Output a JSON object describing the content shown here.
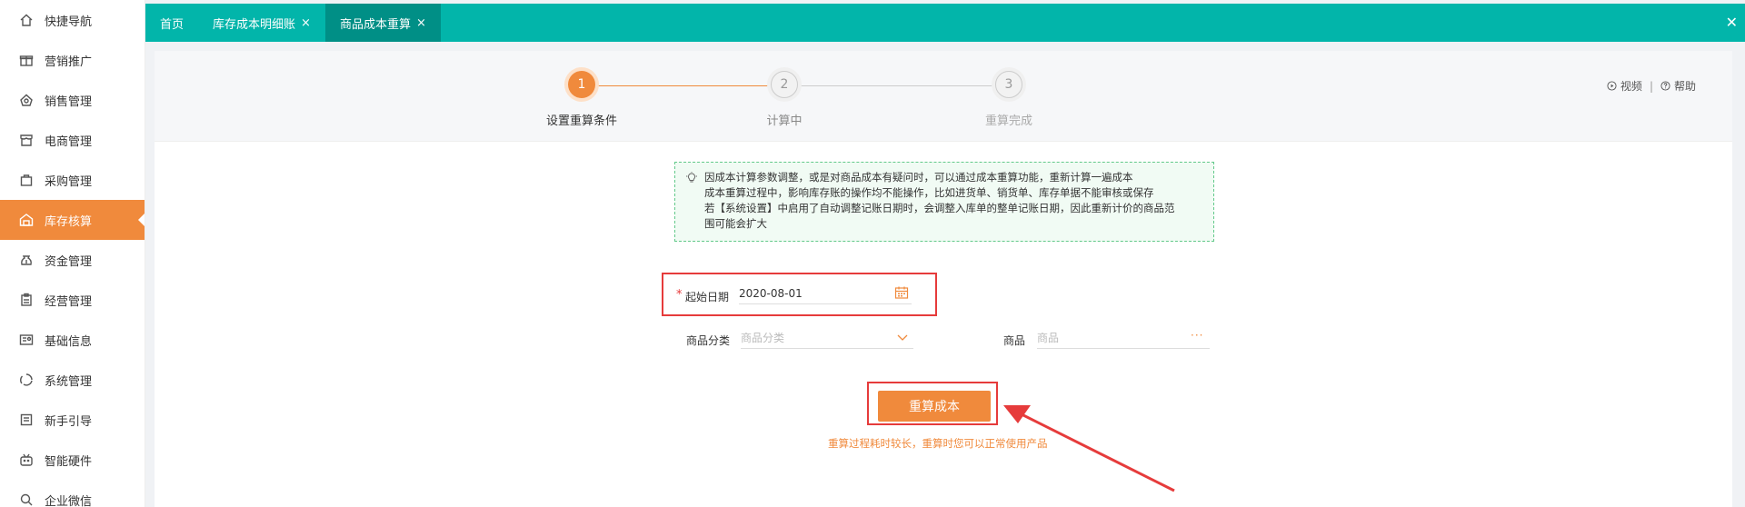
{
  "sidebar": {
    "items": [
      {
        "label": "快捷导航",
        "icon": "home-icon"
      },
      {
        "label": "营销推广",
        "icon": "gift-icon"
      },
      {
        "label": "销售管理",
        "icon": "sales-icon"
      },
      {
        "label": "电商管理",
        "icon": "store-icon"
      },
      {
        "label": "采购管理",
        "icon": "bag-icon"
      },
      {
        "label": "库存核算",
        "icon": "warehouse-icon"
      },
      {
        "label": "资金管理",
        "icon": "money-bag-icon"
      },
      {
        "label": "经营管理",
        "icon": "clipboard-icon"
      },
      {
        "label": "基础信息",
        "icon": "id-card-icon"
      },
      {
        "label": "系统管理",
        "icon": "cycle-icon"
      },
      {
        "label": "新手引导",
        "icon": "guide-icon"
      },
      {
        "label": "智能硬件",
        "icon": "device-icon"
      },
      {
        "label": "企业微信",
        "icon": "search-icon"
      }
    ],
    "active_index": 5
  },
  "tabs": [
    {
      "label": "首页",
      "closable": false
    },
    {
      "label": "库存成本明细账",
      "closable": true
    },
    {
      "label": "商品成本重算",
      "closable": true
    }
  ],
  "tab_close_glyph": "×",
  "close_all_glyph": "✕",
  "steps": [
    {
      "number": "1",
      "label": "设置重算条件"
    },
    {
      "number": "2",
      "label": "计算中"
    },
    {
      "number": "3",
      "label": "重算完成"
    }
  ],
  "help": {
    "video_label": "视频",
    "separator": "|",
    "help_label": "帮助"
  },
  "notice": {
    "lines": [
      "因成本计算参数调整，或是对商品成本有疑问时，可以通过成本重算功能，重新计算一遍成本",
      "成本重算过程中，影响库存账的操作均不能操作，比如进货单、销货单、库存单据不能审核或保存",
      "若【系统设置】中启用了自动调整记账日期时，会调整入库单的整单记账日期，因此重新计价的商品范",
      "围可能会扩大"
    ]
  },
  "form": {
    "required_mark": "*",
    "start_date_label": "起始日期",
    "start_date_value": "2020-08-01",
    "category_label": "商品分类",
    "category_placeholder": "商品分类",
    "product_label": "商品",
    "product_placeholder": "商品",
    "more_glyph": "···"
  },
  "action": {
    "recalc_button": "重算成本",
    "tip": "重算过程耗时较长，重算时您可以正常使用产品"
  },
  "colors": {
    "accent": "#f08a3c",
    "teal": "#02b5aa",
    "highlight": "#e63b3b"
  }
}
